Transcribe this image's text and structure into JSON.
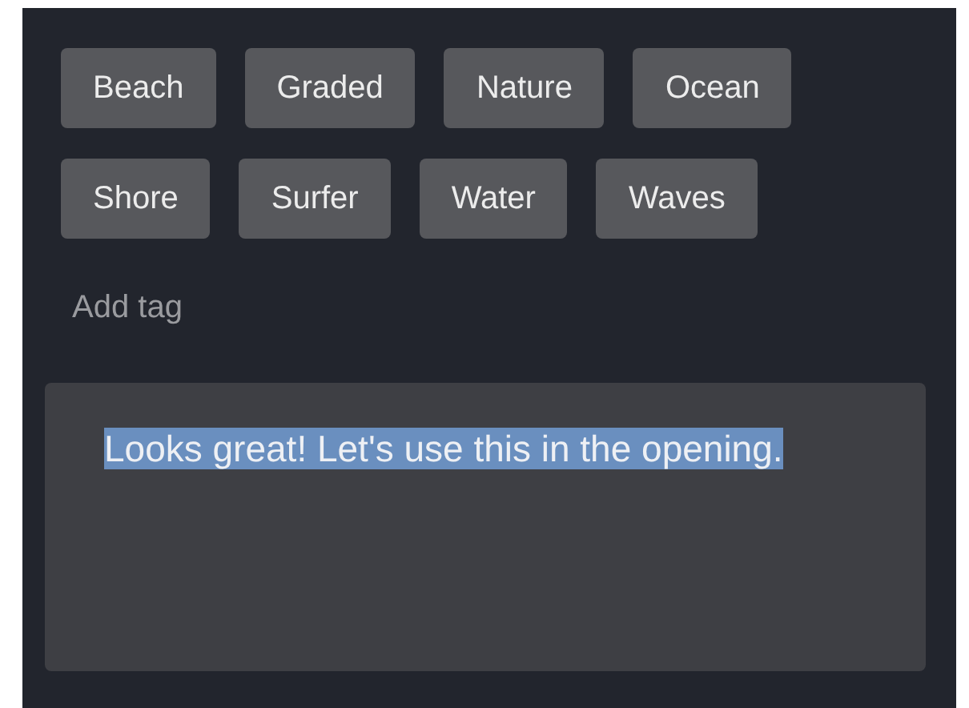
{
  "tags": [
    {
      "label": "Beach"
    },
    {
      "label": "Graded"
    },
    {
      "label": "Nature"
    },
    {
      "label": "Ocean"
    },
    {
      "label": "Shore"
    },
    {
      "label": "Surfer"
    },
    {
      "label": "Water"
    },
    {
      "label": "Waves"
    }
  ],
  "add_tag": {
    "placeholder": "Add tag"
  },
  "comment": {
    "value": "Looks great! Let's use this in the opening.",
    "selected": true
  }
}
